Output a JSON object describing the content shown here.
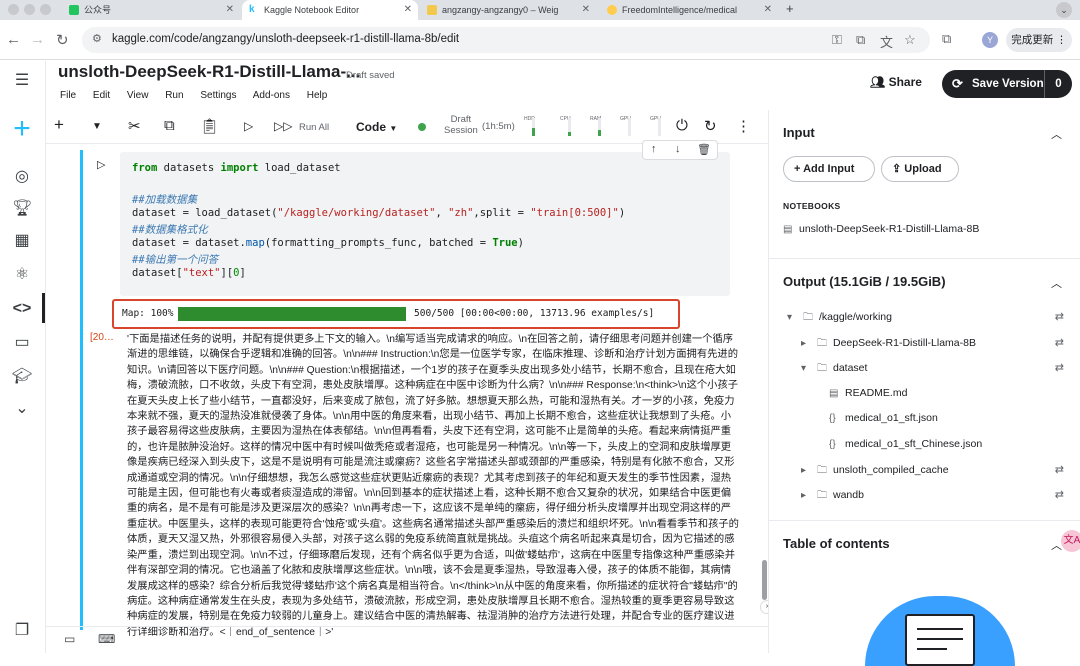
{
  "browser": {
    "tabs": [
      {
        "label": "公众号",
        "active": false
      },
      {
        "label": "Kaggle Notebook Editor",
        "active": true
      },
      {
        "label": "angzangy-angzangy0 – Weig",
        "active": false
      },
      {
        "label": "FreedomIntelligence/medical",
        "active": false
      }
    ],
    "url": "kaggle.com/code/angzangy/unsloth-deepseek-r1-distill-llama-8b/edit",
    "update_label": "完成更新",
    "profile_letter": "Y"
  },
  "header": {
    "title": "unsloth-DeepSeek-R1-Distill-Llama-...",
    "status": "Draft saved",
    "menu": [
      "File",
      "Edit",
      "View",
      "Run",
      "Settings",
      "Add-ons",
      "Help"
    ],
    "share_label": "Share",
    "save_label": "Save Version",
    "save_count": "0"
  },
  "toolbar": {
    "run_all": "Run All",
    "cell_type": "Code",
    "session_line1": "Draft",
    "session_line2": "Session",
    "session_time": "(1h:5m)",
    "meters": [
      "HDD",
      "CPU",
      "RAM",
      "GPU",
      "GPU"
    ]
  },
  "cell": {
    "code_lines": [
      "from datasets import load_dataset",
      "",
      "##加载数据集",
      "dataset = load_dataset(\"/kaggle/working/dataset\", \"zh\",split = \"train[0:500]\")",
      "##数据集格式化",
      "dataset = dataset.map(formatting_prompts_func, batched = True)",
      "##输出第一个问答",
      "dataset[\"text\"][0]"
    ],
    "progress_label": "Map: 100%",
    "progress_stats": "500/500 [00:00<00:00, 13713.96 examples/s]",
    "progress_fraction": 1.0,
    "output_prompt": "[20…",
    "output_text": "'下面是描述任务的说明，并配有提供更多上下文的输入。\\n编写适当完成请求的响应。\\n在回答之前，请仔细思考问题并创建一个循序渐进的思维链，以确保合乎逻辑和准确的回答。\\n\\n### Instruction:\\n您是一位医学专家，在临床推理、诊断和治疗计划方面拥有先进的知识。\\n请回答以下医疗问题。\\n\\n### Question:\\n根据描述，一个1岁的孩子在夏季头皮出现多处小结节，长期不愈合，且现在疮大如梅，溃破流脓，口不收敛，头皮下有空洞，患处皮肤增厚。这种病症在中医中诊断为什么病？\\n\\n### Response:\\n<think>\\n这个小孩子在夏天头皮上长了些小结节，一直都没好，后来变成了脓包，流了好多脓。想想夏天那么热，可能和湿热有关。才一岁的小孩，免疫力本来就不强，夏天的湿热没准就侵袭了身体。\\n\\n用中医的角度来看，出现小结节、再加上长期不愈合，这些症状让我想到了头疮。小孩子最容易得这些皮肤病，主要因为湿热在体表郁结。\\n\\n但再看看，头皮下还有空洞，这可能不止是简单的头疮。看起来病情挺严重的，也许是脓肿没治好。这样的情况中医中有时候叫做秃疮或者湿疮，也可能是另一种情况。\\n\\n等一下，头皮上的空洞和皮肤增厚更像是疾病已经深入到头皮下，这是不是说明有可能是流注或瘰疬？这些名字常描述头部或颈部的严重感染，特别是有化脓不愈合，又形成通道或空洞的情况。\\n\\n仔细想想，我怎么感觉这些症状更贴近瘰疬的表现？尤其考虑到孩子的年纪和夏天发生的季节性因素，湿热可能是主因，但可能也有火毒或者痰湿造成的滞留。\\n\\n回到基本的症状描述上看，这种长期不愈合又复杂的状况，如果结合中医更偏重的病名，是不是有可能是涉及更深层次的感染？\\n\\n再考虑一下，这应该不是单纯的瘰疬，得仔细分析头皮增厚并出现空洞这样的严重症状。中医里头，这样的表现可能更符合'蚀疮'或'头疽'。这些病名通常描述头部严重感染后的溃烂和组织坏死。\\n\\n看看季节和孩子的体质，夏天又湿又热，外邪很容易侵入头部，对孩子这么弱的免疫系统简直就是挑战。头疽这个病名听起来真是切合，因为它描述的感染严重，溃烂到出现空洞。\\n\\n不过，仔细琢磨后发现，还有个病名似乎更为合适，叫做'蝼蛄疖'，这病在中医里专指像这种严重感染并伴有深部空洞的情况。它也涵盖了化脓和皮肤增厚这些症状。\\n\\n哦，该不会是夏季湿热，导致湿毒入侵，孩子的体质不能御，其病情发展成这样的感染？综合分析后我觉得'蝼蛄疖'这个病名真是相当符合。\\n</think>\\n从中医的角度来看，你所描述的症状符合\"蝼蛄疖\"的病症。这种病症通常发生在头皮，表现为多处结节，溃破流脓，形成空洞，患处皮肤增厚且长期不愈合。湿热较重的夏季更容易导致这种病症的发展，特别是在免疫力较弱的儿童身上。建议结合中医的清热解毒、祛湿消肿的治疗方法进行处理，并配合专业的医疗建议进行详细诊断和治疗。<｜end_of_sentence｜>'"
  },
  "panel": {
    "input_title": "Input",
    "add_input": "Add Input",
    "upload": "Upload",
    "notebooks_label": "NOTEBOOKS",
    "notebook_item": "unsloth-DeepSeek-R1-Distill-Llama-8B",
    "output_title": "Output (15.1GiB / 19.5GiB)",
    "tree": {
      "root": "/kaggle/working",
      "items": [
        "DeepSeek-R1-Distill-Llama-8B",
        "dataset",
        "README.md",
        "medical_o1_sft.json",
        "medical_o1_sft_Chinese.json",
        "unsloth_compiled_cache",
        "wandb"
      ]
    },
    "toc_title": "Table of contents"
  },
  "colors": {
    "accent": "#20beff",
    "progress": "#2e8b2e",
    "highlight_border": "#d9442c",
    "save_button": "#202124"
  }
}
